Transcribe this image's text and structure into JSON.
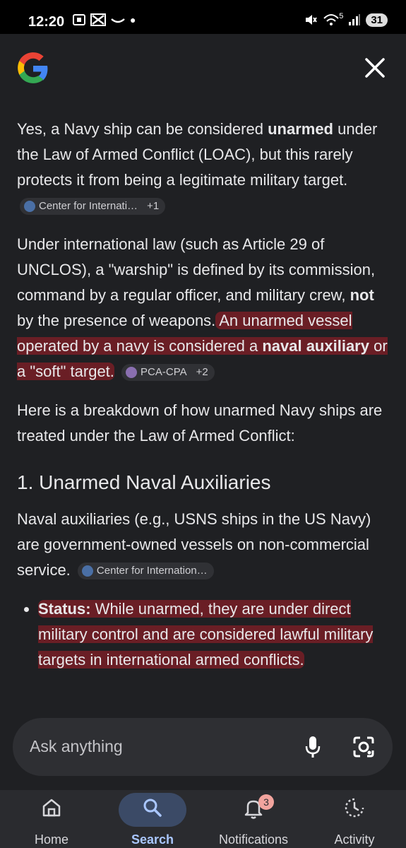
{
  "status_bar": {
    "time": "12:20",
    "left_icons": [
      "screenshot-icon",
      "capcut-icon",
      "amazon-icon",
      "dot-icon"
    ],
    "signal_5g": "5",
    "battery": "31"
  },
  "header": {
    "logo": "google-g-logo",
    "close_icon": "close-icon"
  },
  "content": {
    "p1": {
      "t1": "Yes, a Navy ship can be considered ",
      "b1": "unarmed",
      "t2": " under the Law of Armed Conflict (LOAC), but this rarely protects it from being a legitimate military target.",
      "chip_label": "Center for Internati…",
      "chip_count": "+1"
    },
    "p2": {
      "t1": "Under international law (such as Article 29 of UNCLOS), a \"warship\" is defined by its commission, command by a regular officer, and military crew, ",
      "b1": "not",
      "t2": " by the presence of weapons.",
      "t3": " An unarmed vessel operated by a navy is considered a ",
      "b2": "naval auxiliary",
      "t4": " or a \"soft\" target.",
      "chip_label": "PCA-CPA",
      "chip_count": "+2"
    },
    "p3": "Here is a breakdown of how unarmed Navy ships are treated under the Law of Armed Conflict:",
    "section_heading": "1. Unarmed Naval Auxiliaries",
    "p4": {
      "text": "Naval auxiliaries (e.g., USNS ships in the US Navy) are government-owned vessels on non-commercial service.",
      "chip_label": "Center for Internation…"
    },
    "bullet1": {
      "label": "Status:",
      "text": " While unarmed, they are under direct military control and are considered lawful military targets in international armed conflicts."
    }
  },
  "ask_bar": {
    "placeholder": "Ask anything",
    "mic_icon": "microphone-icon",
    "lens_icon": "camera-lens-icon"
  },
  "bottom_nav": {
    "items": [
      {
        "label": "Home",
        "icon": "home-icon"
      },
      {
        "label": "Search",
        "icon": "search-icon",
        "active": true
      },
      {
        "label": "Notifications",
        "icon": "bell-icon",
        "badge": "3"
      },
      {
        "label": "Activity",
        "icon": "activity-icon"
      }
    ]
  },
  "colors": {
    "background": "#1f2023",
    "highlight": "#a81e28",
    "active_nav": "#aac7ff"
  }
}
